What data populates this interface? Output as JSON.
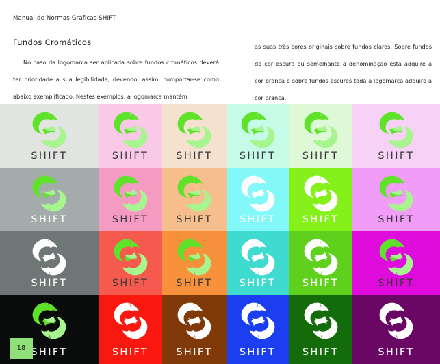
{
  "header": {
    "manual_title": "Manual de Normas Gráficas SHIFT"
  },
  "section": {
    "title": "Fundos Cromáticos"
  },
  "body": {
    "left_text": "No caso da logomarca ser aplicada sobre fundos cromáticos deverá ter prioridade a sua legibilidade, devendo, assim, comportar-se como abaixo exemplificado. Nestes exemplos, a logomarca mantém",
    "right_text": "as suas três cores originais sobre fundos claros. Sobre fundos de cor escura ou semelhante à denominação esta adquire a cor branca e sobre fundos escuros toda a logomarca adquire a cor branca."
  },
  "logo": {
    "wordmark": "SHIFT"
  },
  "palette": {
    "logo_green": "#5ee32a",
    "logo_light_green": "#a7f58e",
    "white": "#ffffff"
  },
  "swatches": [
    [
      {
        "bg": "#e1e4e1",
        "variant": "color",
        "text": "#3a3a3a"
      },
      {
        "bg": "#f9c9e7",
        "variant": "color",
        "text": "#3a3a3a"
      },
      {
        "bg": "#f4e1cf",
        "variant": "color",
        "text": "#3a3a3a"
      },
      {
        "bg": "#c6fbe8",
        "variant": "color",
        "text": "#3a3a3a"
      },
      {
        "bg": "#dff9d8",
        "variant": "color",
        "text": "#3a3a3a"
      },
      {
        "bg": "#f6d3f6",
        "variant": "color",
        "text": "#3a3a3a"
      }
    ],
    [
      {
        "bg": "#a4abab",
        "variant": "color",
        "text": "#ffffff"
      },
      {
        "bg": "#f59bc2",
        "variant": "color",
        "text": "#3a3a3a"
      },
      {
        "bg": "#f6be8c",
        "variant": "color",
        "text": "#3a3a3a"
      },
      {
        "bg": "#82f8f8",
        "variant": "white",
        "text": "#ffffff"
      },
      {
        "bg": "#85f01a",
        "variant": "white",
        "text": "#ffffff"
      },
      {
        "bg": "#f19cf6",
        "variant": "color",
        "text": "#3a3a3a"
      }
    ],
    [
      {
        "bg": "#6f7776",
        "variant": "white",
        "text": "#ffffff"
      },
      {
        "bg": "#f65a4e",
        "variant": "color",
        "text": "#3a3a3a"
      },
      {
        "bg": "#f7913c",
        "variant": "color",
        "text": "#3a3a3a"
      },
      {
        "bg": "#3fdad0",
        "variant": "white",
        "text": "#ffffff"
      },
      {
        "bg": "#5fd01c",
        "variant": "white",
        "text": "#ffffff"
      },
      {
        "bg": "#df0bdd",
        "variant": "color",
        "text": "#3a3a3a"
      }
    ],
    [
      {
        "bg": "#0a0b0b",
        "variant": "color",
        "text": "#ffffff"
      },
      {
        "bg": "#f8180f",
        "variant": "white",
        "text": "#ffffff"
      },
      {
        "bg": "#803908",
        "variant": "white",
        "text": "#ffffff"
      },
      {
        "bg": "#1a3ef0",
        "variant": "white",
        "text": "#ffffff"
      },
      {
        "bg": "#136c09",
        "variant": "white",
        "text": "#ffffff"
      },
      {
        "bg": "#6a0764",
        "variant": "white",
        "text": "#ffffff"
      }
    ]
  ],
  "footer": {
    "page_number": "18"
  }
}
